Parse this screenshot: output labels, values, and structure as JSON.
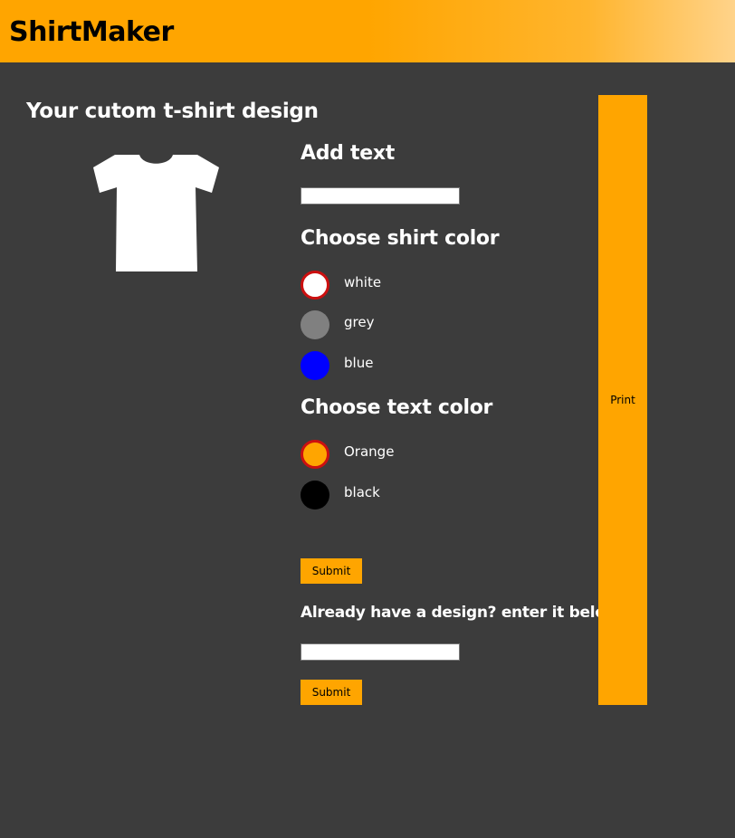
{
  "header": {
    "title": "ShirtMaker"
  },
  "design": {
    "title": "Your cutom t-shirt design",
    "preview_shirt_color": "white"
  },
  "add_text": {
    "heading": "Add text",
    "value": "",
    "placeholder": ""
  },
  "shirt_color": {
    "heading": "Choose shirt color",
    "selected": "white",
    "options": [
      {
        "label": "white",
        "color": "#ffffff",
        "selected": true
      },
      {
        "label": "grey",
        "color": "#808080",
        "selected": false
      },
      {
        "label": "blue",
        "color": "#0000ff",
        "selected": false
      }
    ]
  },
  "text_color": {
    "heading": "Choose text color",
    "selected": "Orange",
    "options": [
      {
        "label": "Orange",
        "color": "#ffa500",
        "selected": true
      },
      {
        "label": "black",
        "color": "#000000",
        "selected": false
      }
    ]
  },
  "submit_label": "Submit",
  "existing_design": {
    "heading": "Already have a design? enter it below",
    "value": "",
    "placeholder": "",
    "submit_label": "Submit"
  },
  "print_label": "Print",
  "colors": {
    "accent": "#ffa500",
    "background": "#3c3c3c",
    "selected_ring": "#cc1010"
  }
}
